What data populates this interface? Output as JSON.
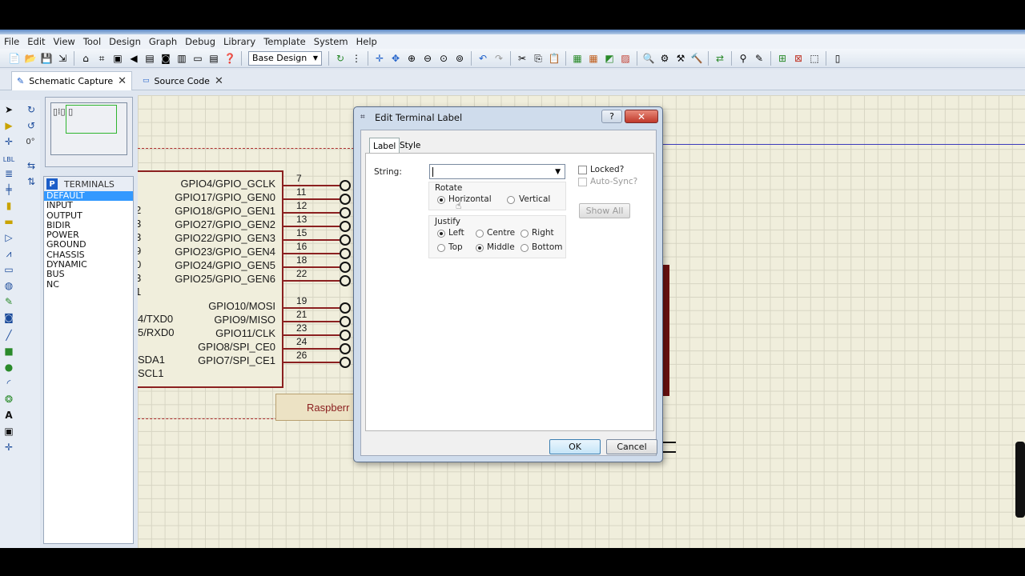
{
  "menu": [
    "File",
    "Edit",
    "View",
    "Tool",
    "Design",
    "Graph",
    "Debug",
    "Library",
    "Template",
    "System",
    "Help"
  ],
  "toolbar": {
    "design_combo": "Base Design"
  },
  "tabs": [
    {
      "label": "Schematic Capture",
      "close": "✕"
    },
    {
      "label": "Source Code",
      "close": "✕"
    }
  ],
  "left": {
    "rotation": "0°"
  },
  "terminals": {
    "badge": "P",
    "header": "TERMINALS",
    "items": [
      "DEFAULT",
      "INPUT",
      "OUTPUT",
      "BIDIR",
      "POWER",
      "GROUND",
      "CHASSIS",
      "DYNAMIC",
      "BUS",
      "NC"
    ]
  },
  "chip": {
    "pins_right": [
      {
        "label": "GPIO4/GPIO_GCLK",
        "num": "7"
      },
      {
        "label": "GPIO17/GPIO_GEN0",
        "num": "11"
      },
      {
        "label": "GPIO18/GPIO_GEN1",
        "num": "12"
      },
      {
        "label": "GPIO27/GPIO_GEN2",
        "num": "13"
      },
      {
        "label": "GPIO22/GPIO_GEN3",
        "num": "15"
      },
      {
        "label": "GPIO23/GPIO_GEN4",
        "num": "16"
      },
      {
        "label": "GPIO24/GPIO_GEN5",
        "num": "18"
      },
      {
        "label": "GPIO25/GPIO_GEN6",
        "num": "22"
      },
      {
        "label": "GPIO10/MOSI",
        "num": "19"
      },
      {
        "label": "GPIO9/MISO",
        "num": "21"
      },
      {
        "label": "GPIO11/CLK",
        "num": "23"
      },
      {
        "label": "GPIO8/SPI_CE0",
        "num": "24"
      },
      {
        "label": "GPIO7/SPI_CE1",
        "num": "26"
      }
    ],
    "left_fragments": [
      "2",
      "3",
      "3",
      "9",
      "0",
      "3",
      "1",
      "4/TXD0",
      "5/RXD0",
      "SDA1",
      "SCL1"
    ],
    "caption": "Raspberr"
  },
  "dialog": {
    "title": "Edit Terminal Label",
    "help": "?",
    "close": "✕",
    "tabs": [
      "Label",
      "Style"
    ],
    "string_label": "String:",
    "string_value": "",
    "rotate_label": "Rotate",
    "rotate_options": [
      "Horizontal",
      "Vertical"
    ],
    "justify_label": "Justify",
    "justify_options": [
      "Left",
      "Centre",
      "Right",
      "Top",
      "Middle",
      "Bottom"
    ],
    "locked_label": "Locked?",
    "autosync_label": "Auto-Sync?",
    "show_all": "Show All",
    "ok": "OK",
    "cancel": "Cancel"
  }
}
